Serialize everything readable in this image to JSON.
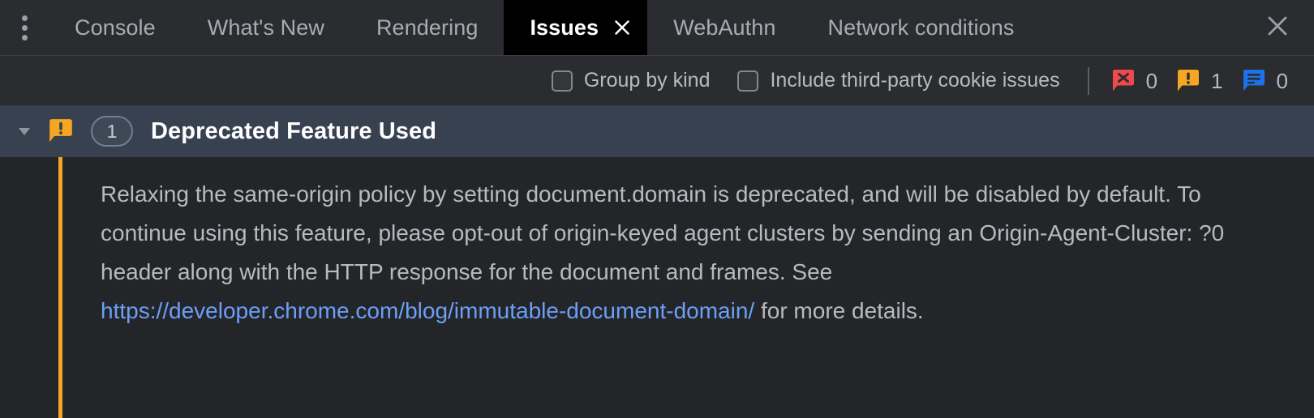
{
  "window": {
    "kebab_menu_label": "more-tabs",
    "panel_close_label": "Close DevTools drawer"
  },
  "tabbar": {
    "tabs": [
      {
        "label": "Console",
        "active": false,
        "closable": false
      },
      {
        "label": "What's New",
        "active": false,
        "closable": false
      },
      {
        "label": "Rendering",
        "active": false,
        "closable": false
      },
      {
        "label": "Issues",
        "active": true,
        "closable": true
      },
      {
        "label": "WebAuthn",
        "active": false,
        "closable": false
      },
      {
        "label": "Network conditions",
        "active": false,
        "closable": false
      }
    ]
  },
  "toolbar": {
    "checkboxes": [
      {
        "label": "Group by kind",
        "checked": false
      },
      {
        "label": "Include third-party cookie issues",
        "checked": false
      }
    ],
    "counters": [
      {
        "kind": "error",
        "icon": "error-bubble-icon",
        "count": "0",
        "color": "#ee4a4a"
      },
      {
        "kind": "warning",
        "icon": "warning-bubble-icon",
        "count": "1",
        "color": "#f5a623"
      },
      {
        "kind": "info",
        "icon": "info-bubble-icon",
        "count": "0",
        "color": "#1a73e8"
      }
    ]
  },
  "issue": {
    "expanded": true,
    "kind_icon": "warning-bubble-icon",
    "kind_color": "#f5a623",
    "count": "1",
    "title": "Deprecated Feature Used",
    "body_part_1": "Relaxing the same-origin policy by setting document.domain is deprecated, and will be disabled by default. To continue using this feature, please opt-out of origin-keyed agent clusters by sending an Origin-Agent-Cluster: ?0 header along with the HTTP response for the document and frames. See ",
    "body_link": "https://developer.chrome.com/blog/immutable-document-domain/",
    "body_part_2": " for more details."
  },
  "colors": {
    "tabbar_bg": "#2b2c30",
    "active_tab_bg": "#000000",
    "panel_bg": "#242529",
    "issue_header_bg": "#374150",
    "accent_warning": "#f5a623",
    "accent_error": "#ee4a4a",
    "accent_info": "#1a73e8",
    "link": "#6aa0f7",
    "text_primary": "#ffffff",
    "text_secondary": "#b6bbc0"
  }
}
